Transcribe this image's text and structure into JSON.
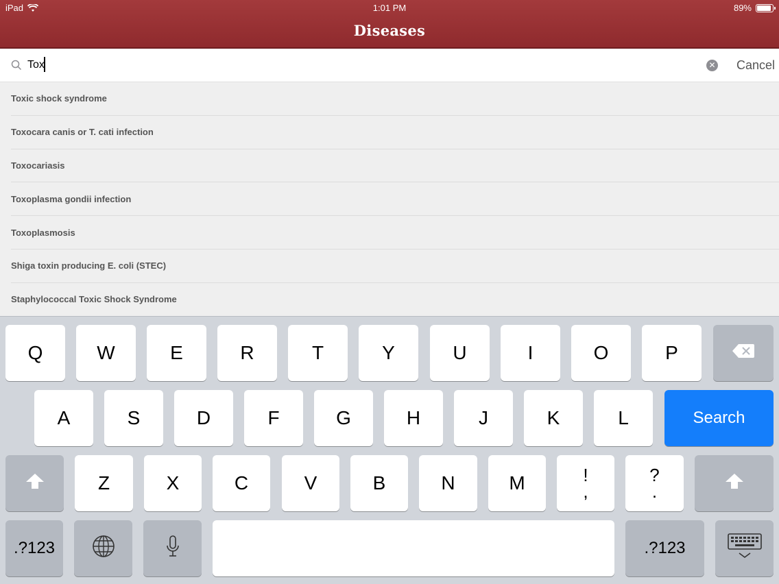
{
  "status_bar": {
    "carrier": "iPad",
    "time": "1:01 PM",
    "battery": "89%",
    "battery_level": 0.89
  },
  "nav": {
    "title": "Diseases"
  },
  "search": {
    "value": "Tox",
    "cancel_label": "Cancel",
    "clear_glyph": "✕"
  },
  "results": [
    "Toxic shock syndrome",
    "Toxocara canis or T. cati infection",
    "Toxocariasis",
    "Toxoplasma gondii infection",
    "Toxoplasmosis",
    "Shiga toxin producing E. coli (STEC)",
    "Staphylococcal Toxic Shock Syndrome"
  ],
  "keyboard": {
    "row1": [
      "Q",
      "W",
      "E",
      "R",
      "T",
      "Y",
      "U",
      "I",
      "O",
      "P"
    ],
    "row2": [
      "A",
      "S",
      "D",
      "F",
      "G",
      "H",
      "J",
      "K",
      "L"
    ],
    "row3": [
      "Z",
      "X",
      "C",
      "V",
      "B",
      "N",
      "M"
    ],
    "punct1_top": "!",
    "punct1_bottom": ",",
    "punct2_top": "?",
    "punct2_bottom": ".",
    "search_label": "Search",
    "numbers_label": ".?123",
    "numbers_label_right": ".?123"
  },
  "colors": {
    "nav_bar": "#962f32",
    "search_key": "#147efb"
  }
}
